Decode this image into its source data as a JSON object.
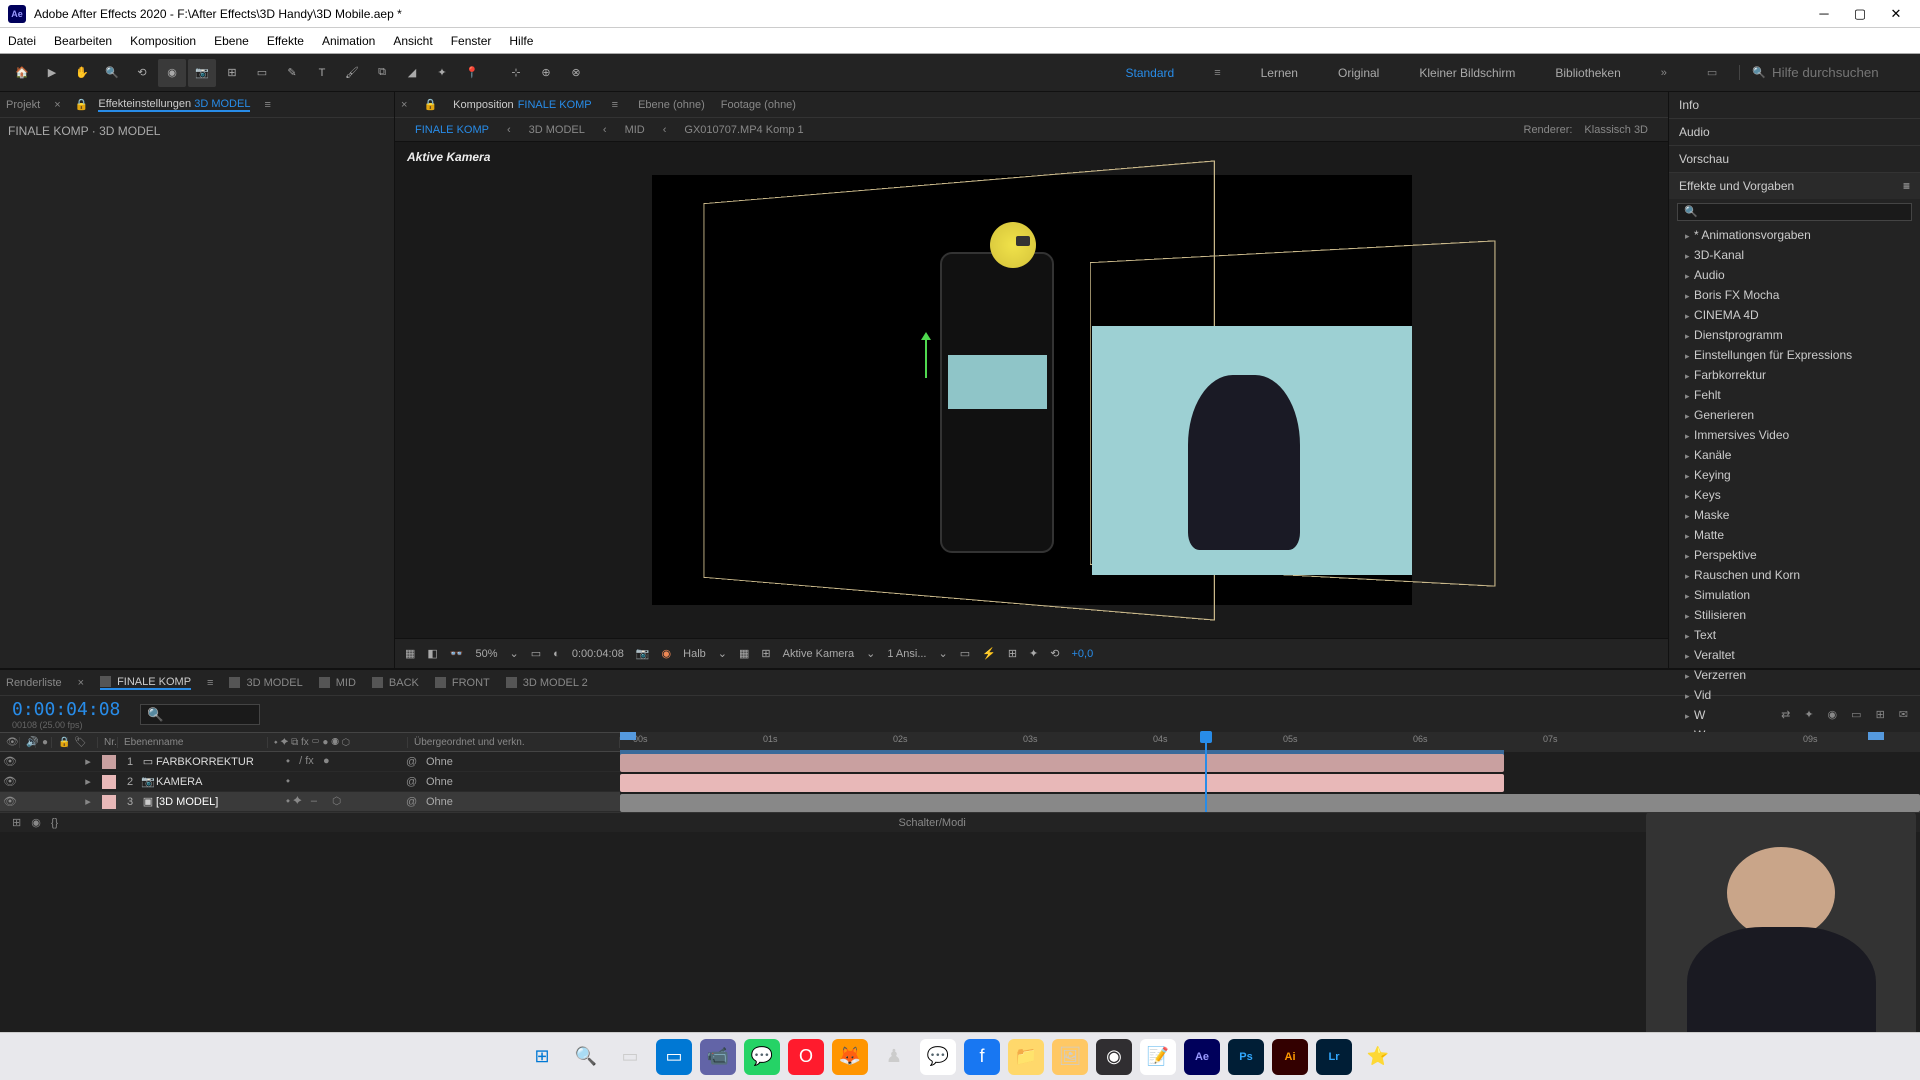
{
  "titlebar": {
    "icon": "Ae",
    "title": "Adobe After Effects 2020 - F:\\After Effects\\3D Handy\\3D Mobile.aep *"
  },
  "menus": [
    "Datei",
    "Bearbeiten",
    "Komposition",
    "Ebene",
    "Effekte",
    "Animation",
    "Ansicht",
    "Fenster",
    "Hilfe"
  ],
  "workspace_tabs": {
    "active": "Standard",
    "items": [
      "Standard",
      "Lernen",
      "Original",
      "Kleiner Bildschirm",
      "Bibliotheken"
    ]
  },
  "search_help_placeholder": "Hilfe durchsuchen",
  "left_panel": {
    "tab1": "Projekt",
    "tab2_prefix": "Effekteinstellungen ",
    "tab2_highlight": "3D MODEL",
    "path": "FINALE KOMP · 3D MODEL"
  },
  "center": {
    "comp_tab_prefix": "Komposition ",
    "comp_tab_highlight": "FINALE KOMP",
    "ebene_tab": "Ebene (ohne)",
    "footage_tab": "Footage (ohne)",
    "flow": [
      "FINALE KOMP",
      "3D MODEL",
      "MID",
      "GX010707.MP4 Komp 1"
    ],
    "renderer_label": "Renderer:",
    "renderer_value": "Klassisch 3D",
    "viewer_label": "Aktive Kamera"
  },
  "viewer_controls": {
    "zoom": "50%",
    "timecode": "0:00:04:08",
    "resolution": "Halb",
    "camera": "Aktive Kamera",
    "views": "1 Ansi...",
    "exposure": "+0,0"
  },
  "right_panel": {
    "sections": [
      "Info",
      "Audio",
      "Vorschau",
      "Effekte und Vorgaben"
    ],
    "effects": [
      "* Animationsvorgaben",
      "3D-Kanal",
      "Audio",
      "Boris FX Mocha",
      "CINEMA 4D",
      "Dienstprogramm",
      "Einstellungen für Expressions",
      "Farbkorrektur",
      "Fehlt",
      "Generieren",
      "Immersives Video",
      "Kanäle",
      "Keying",
      "Keys",
      "Maske",
      "Matte",
      "Perspektive",
      "Rauschen und Korn",
      "Simulation",
      "Stilisieren",
      "Text",
      "Veraltet",
      "Verzerren",
      "Vid",
      "W",
      "W"
    ]
  },
  "timeline": {
    "render_tab": "Renderliste",
    "tabs": [
      "FINALE KOMP",
      "3D MODEL",
      "MID",
      "BACK",
      "FRONT",
      "3D MODEL 2"
    ],
    "active_tab": "FINALE KOMP",
    "timecode": "0:00:04:08",
    "timecode_sub": "00108 (25.00 fps)",
    "header_name": "Ebenenname",
    "header_parent": "Übergeordnet und verkn.",
    "layers": [
      {
        "num": "1",
        "name": "FARBKORREKTUR",
        "color": "#c9a0a0",
        "parent": "Ohne"
      },
      {
        "num": "2",
        "name": "KAMERA",
        "color": "#e8b8b8",
        "parent": "Ohne"
      },
      {
        "num": "3",
        "name": "[3D MODEL]",
        "color": "#e8b8b8",
        "parent": "Ohne",
        "selected": true
      }
    ],
    "time_marks": [
      "00s",
      "01s",
      "02s",
      "03s",
      "04s",
      "05s",
      "06s",
      "07s",
      "09s"
    ],
    "footer_label": "Schalter/Modi"
  },
  "taskbar_icons": [
    "windows",
    "search",
    "tasks",
    "edge",
    "teams",
    "whatsapp",
    "opera",
    "firefox",
    "chess",
    "messenger",
    "facebook",
    "explorer",
    "picasa",
    "obs",
    "notepad",
    "ae",
    "ps",
    "ai",
    "lr",
    "star"
  ]
}
